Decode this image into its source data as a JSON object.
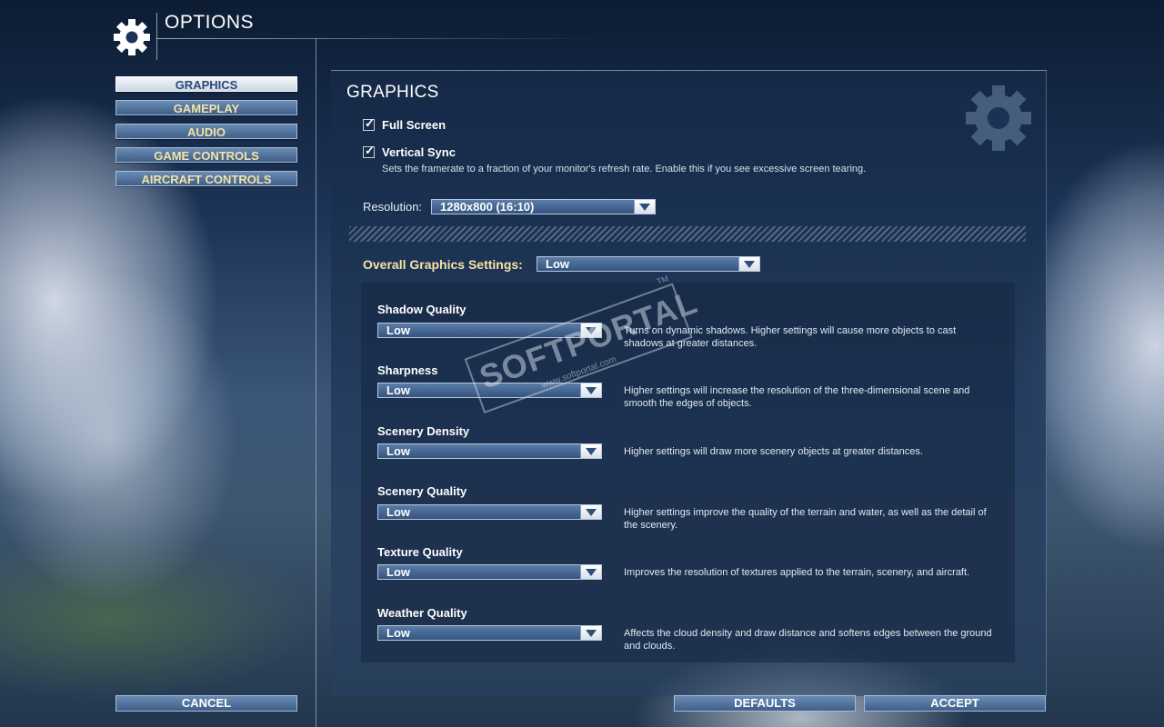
{
  "header": {
    "title": "OPTIONS"
  },
  "nav": [
    {
      "label": "GRAPHICS",
      "active": true
    },
    {
      "label": "GAMEPLAY",
      "active": false
    },
    {
      "label": "AUDIO",
      "active": false
    },
    {
      "label": "GAME CONTROLS",
      "active": false
    },
    {
      "label": "AIRCRAFT CONTROLS",
      "active": false
    }
  ],
  "panel": {
    "title": "GRAPHICS",
    "fullscreen": {
      "label": "Full Screen",
      "checked": true
    },
    "vsync": {
      "label": "Vertical Sync",
      "checked": true,
      "description": "Sets the framerate to a fraction of your monitor's refresh rate. Enable this if you see excessive screen tearing."
    },
    "resolution": {
      "label": "Resolution:",
      "value": "1280x800 (16:10)"
    },
    "overall": {
      "label": "Overall Graphics Settings:",
      "value": "Low"
    },
    "settings": [
      {
        "label": "Shadow Quality",
        "value": "Low",
        "description": "Turns on dynamic shadows. Higher settings will cause more objects to cast shadows at greater distances."
      },
      {
        "label": "Sharpness",
        "value": "Low",
        "description": "Higher settings will increase the resolution of the three-dimensional scene and smooth the edges of objects."
      },
      {
        "label": "Scenery Density",
        "value": "Low",
        "description": "Higher settings will draw more scenery objects at greater distances."
      },
      {
        "label": "Scenery Quality",
        "value": "Low",
        "description": "Higher settings improve the quality of the terrain and water, as well as the detail of the scenery."
      },
      {
        "label": "Texture Quality",
        "value": "Low",
        "description": "Improves the resolution of textures applied to the terrain, scenery, and aircraft."
      },
      {
        "label": "Weather Quality",
        "value": "Low",
        "description": "Affects the cloud density and draw distance and softens edges between the ground and clouds."
      }
    ]
  },
  "watermark": {
    "brand": "SOFTPORTAL",
    "url": "www.softportal.com",
    "tm": "TM"
  },
  "buttons": {
    "cancel": "CANCEL",
    "defaults": "DEFAULTS",
    "accept": "ACCEPT"
  },
  "icons": {
    "header": "gear-icon",
    "panel": "gear-icon",
    "check": "check-icon",
    "dropdown": "chevron-down-icon"
  },
  "colors": {
    "accent_gold": "#f3e4a4",
    "button_blue": "#4f6f98",
    "active_button": "#e6ecf4"
  }
}
